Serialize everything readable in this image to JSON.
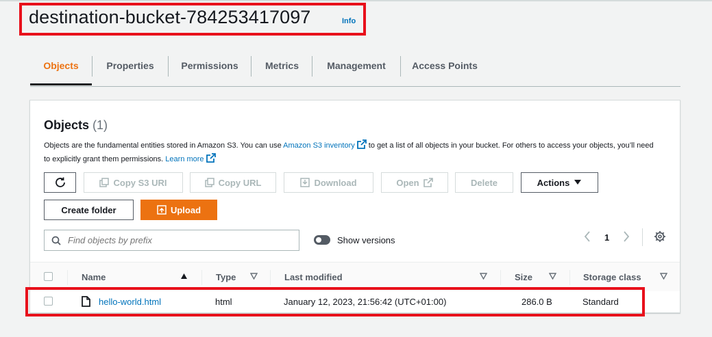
{
  "bucket": {
    "title": "destination-bucket-784253417097",
    "info": "Info"
  },
  "tabs": [
    {
      "label": "Objects",
      "active": true
    },
    {
      "label": "Properties"
    },
    {
      "label": "Permissions"
    },
    {
      "label": "Metrics"
    },
    {
      "label": "Management"
    },
    {
      "label": "Access Points"
    }
  ],
  "objects_panel": {
    "title": "Objects",
    "count": "(1)",
    "description_part1": "Objects are the fundamental entities stored in Amazon S3. You can use ",
    "inventory_link": "Amazon S3 inventory",
    "description_part2": " to get a list of all objects in your bucket. For others to access your objects, you’ll need to explicitly grant them permissions. ",
    "learn_more": "Learn more"
  },
  "toolbar": {
    "copy_s3_uri": "Copy S3 URI",
    "copy_url": "Copy URL",
    "download": "Download",
    "open": "Open",
    "delete": "Delete",
    "actions": "Actions",
    "create_folder": "Create folder",
    "upload": "Upload"
  },
  "search": {
    "placeholder": "Find objects by prefix"
  },
  "versions": {
    "label": "Show versions",
    "enabled": false
  },
  "pagination": {
    "current_page": "1"
  },
  "table": {
    "columns": {
      "name": "Name",
      "type": "Type",
      "last_modified": "Last modified",
      "size": "Size",
      "storage_class": "Storage class"
    },
    "rows": [
      {
        "name": "hello-world.html",
        "type": "html",
        "last_modified": "January 12, 2023, 21:56:42 (UTC+01:00)",
        "size": "286.0 B",
        "storage_class": "Standard"
      }
    ]
  },
  "colors": {
    "accent": "#ec7211",
    "link": "#0073bb",
    "highlight": "#e8101b"
  }
}
